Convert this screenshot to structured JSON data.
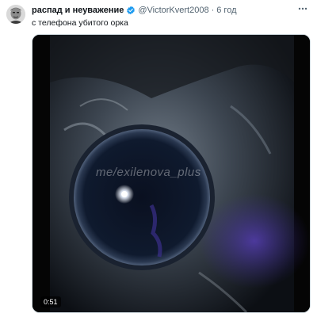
{
  "tweet": {
    "display_name": "распад и неуважение",
    "handle": "@VictorKvert2008",
    "separator": "·",
    "time": "6 год",
    "text": "с телефона убитого орка",
    "verified_badge_color": "#1d9bf0",
    "verified_icon": "verified-badge-icon",
    "more_icon": "more-options-icon"
  },
  "media": {
    "watermark": "me/exilenova_plus",
    "duration": "0:51"
  }
}
